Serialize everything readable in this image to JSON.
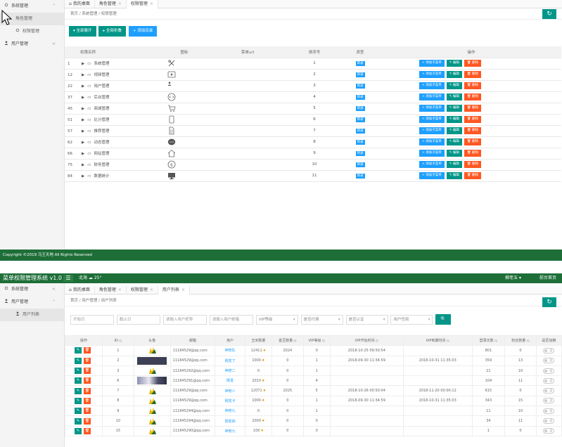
{
  "top": {
    "sidebar": [
      {
        "label": "系统管理",
        "icon": "gear-icon",
        "arrow": "⌃",
        "type": "group"
      },
      {
        "label": "角色管理",
        "type": "sub",
        "active": true
      },
      {
        "label": "权限管理",
        "icon": "gear-icon",
        "type": "sub"
      },
      {
        "label": "用户管理",
        "icon": "user-icon",
        "arrow": "<",
        "type": "group"
      }
    ],
    "tabs": [
      {
        "label": "我的桌面"
      },
      {
        "label": "角色管理",
        "close": "×"
      },
      {
        "label": "权限管理",
        "close": "×",
        "active": true
      }
    ],
    "breadcrumb": "首页 / 系统管理 / 权限管理",
    "refresh_icon": "↻",
    "buttons": {
      "expand": "▾ 全部展开",
      "collapse": "▸ 全部折叠",
      "add": "+ 添加目录"
    },
    "columns": [
      "权限名称",
      "图标",
      "菜单url",
      "排序号",
      "类型",
      "操作"
    ],
    "rows": [
      {
        "id": "1",
        "name": "系统管理",
        "icon": "tools-icon",
        "sort": "1",
        "type": "目录"
      },
      {
        "id": "12",
        "name": "视频管理",
        "icon": "video-icon",
        "sort": "2",
        "type": "目录"
      },
      {
        "id": "22",
        "name": "用户管理",
        "icon": "user-icon",
        "sort": "3",
        "type": "目录"
      },
      {
        "id": "37",
        "name": "后台管理",
        "icon": "code-icon",
        "sort": "4",
        "type": "目录"
      },
      {
        "id": "45",
        "name": "商城管理",
        "icon": "cart-icon",
        "sort": "5",
        "type": "目录"
      },
      {
        "id": "51",
        "name": "比分管理",
        "icon": "mobile-icon",
        "sort": "6",
        "type": "目录"
      },
      {
        "id": "57",
        "name": "推荐管理",
        "icon": "document-icon",
        "sort": "7",
        "type": "目录"
      },
      {
        "id": "62",
        "name": "动态管理",
        "icon": "chat-icon",
        "sort": "8",
        "type": "目录"
      },
      {
        "id": "66",
        "name": "网站管理",
        "icon": "home-icon",
        "sort": "9",
        "type": "目录"
      },
      {
        "id": "75",
        "name": "财务管理",
        "icon": "dollar-icon",
        "sort": "10",
        "type": "目录"
      },
      {
        "id": "84",
        "name": "数据统计",
        "icon": "monitor-icon",
        "sort": "11",
        "type": "目录"
      }
    ],
    "actions": {
      "add_child": "+ 添加子菜单",
      "edit": "✎ 编辑",
      "delete": "🗑 删除"
    },
    "footer": "Copyright ©2019 马王天地 All Rights Reserved"
  },
  "bottom": {
    "header": {
      "brand": "菜单权限管理系统 v1.0",
      "menu_icon": "☰",
      "weather": "北海 ☁ 25°",
      "user": "柳老五 ▾",
      "home": "前台首页"
    },
    "sidebar": [
      {
        "label": "系统管理",
        "icon": "gear-icon",
        "arrow": "<",
        "type": "group"
      },
      {
        "label": "用户管理",
        "icon": "user-icon",
        "arrow": "⌃",
        "type": "group"
      },
      {
        "label": "用户列表",
        "icon": "user-icon",
        "type": "sub",
        "active": true
      }
    ],
    "tabs": [
      {
        "label": "我的桌面"
      },
      {
        "label": "角色管理",
        "close": "×"
      },
      {
        "label": "权限管理",
        "close": "×"
      },
      {
        "label": "用户列表",
        "close": "×",
        "active": true
      }
    ],
    "breadcrumb": "首页 / 用户管理 / 用户列表",
    "refresh_icon": "↻",
    "filters": {
      "start": "开始日",
      "end": "截止日",
      "nickname": "请输入用户昵称",
      "email": "请输入用户邮箱",
      "vip": "VIP等级",
      "paid": "是否付费",
      "verified": "是否认证",
      "gender": "用户性别",
      "search_icon": "🔍"
    },
    "columns": [
      "操作",
      "ID ◇",
      "头像",
      "邮箱",
      "用户",
      "玉米数量",
      "金豆数量 ◇",
      "VIP等级 ◇",
      "VIP开始时间 ◇",
      "VIP到期时间 ◇",
      "登录次数 ◇",
      "粉丝数量 ◇",
      "是否加精"
    ],
    "rows": [
      {
        "id": "1",
        "avatar": "logo",
        "email": "11184529@qq.com",
        "group": "神奇队",
        "corn": "12411",
        "bean": "2024",
        "vip": "0",
        "start": "2018-10-25 09:50:54",
        "end": "",
        "login": "801",
        "fans": "0"
      },
      {
        "id": "2",
        "avatar": "dark",
        "email": "11184529@qq.com",
        "group": "刚发了",
        "corn": "1000",
        "bean": "0",
        "vip": "1",
        "start": "2018-09-30 11:34:59",
        "end": "2018-10-31 11:35:03",
        "login": "359",
        "fans": "13"
      },
      {
        "id": "3",
        "avatar": "logo",
        "email": "111845292@qq.com",
        "group": "神奇二",
        "corn": "0",
        "bean": "0",
        "vip": "1",
        "start": "",
        "end": "",
        "login": "21",
        "fans": "10"
      },
      {
        "id": "6",
        "avatar": "mix",
        "email": "111845291@qq.com",
        "group": "刚发",
        "corn": "2010",
        "bean": "0",
        "vip": "4",
        "start": "",
        "end": "",
        "login": "104",
        "fans": "11"
      },
      {
        "id": "7",
        "avatar": "logo",
        "email": "11184529@qq.com",
        "group": "神奇八",
        "corn": "12071",
        "bean": "2025",
        "vip": "5",
        "start": "2018-10-26 00:50:04",
        "end": "2018-11-20 00:00:12",
        "login": "615",
        "fans": "0"
      },
      {
        "id": "8",
        "avatar": "logo",
        "email": "11184529@qq.com",
        "group": "刚发卡",
        "corn": "1000",
        "bean": "0",
        "vip": "1",
        "start": "2018-09-30 11:34:59",
        "end": "2018-10-31 11:35:03",
        "login": "343",
        "fans": "15"
      },
      {
        "id": "9",
        "avatar": "logo",
        "email": "111845294@qq.com",
        "group": "神奇九",
        "corn": "0",
        "bean": "0",
        "vip": "1",
        "start": "",
        "end": "",
        "login": "11",
        "fans": "10"
      },
      {
        "id": "10",
        "avatar": "logo",
        "email": "111845294@qq.com",
        "group": "刚发四",
        "corn": "2000",
        "bean": "0",
        "vip": "0",
        "start": "",
        "end": "",
        "login": "34",
        "fans": "11"
      },
      {
        "id": "15",
        "avatar": "logo",
        "email": "111845290@qq.com",
        "group": "神奇九",
        "corn": "100",
        "bean": "0",
        "vip": "0",
        "start": "",
        "end": "",
        "login": "1",
        "fans": "0"
      }
    ],
    "toggle_label": "否",
    "edit_icon": "✎",
    "delete_icon": "🗑",
    "accent": "#009688",
    "header_color": "#1e6e38"
  }
}
